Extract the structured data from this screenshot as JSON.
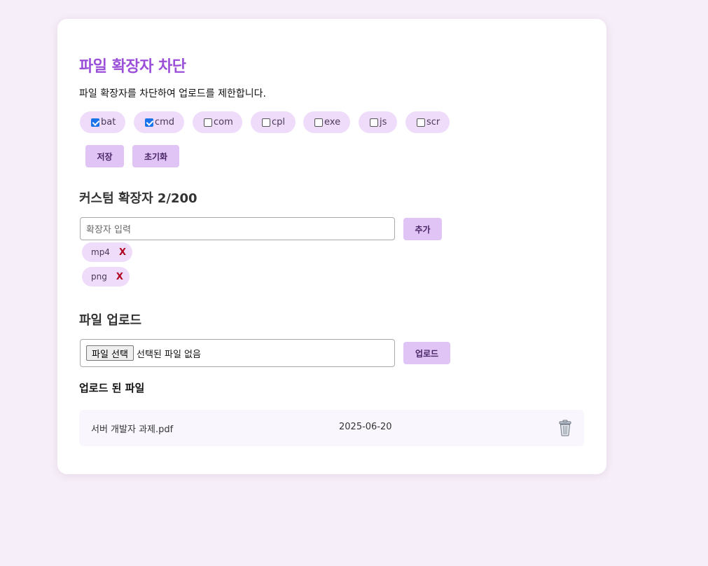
{
  "header": {
    "title": "파일 확장자 차단",
    "description": "파일 확장자를 차단하여 업로드를 제한합니다."
  },
  "fixed_extensions": [
    {
      "label": "bat",
      "checked": true
    },
    {
      "label": "cmd",
      "checked": true
    },
    {
      "label": "com",
      "checked": false
    },
    {
      "label": "cpl",
      "checked": false
    },
    {
      "label": "exe",
      "checked": false
    },
    {
      "label": "js",
      "checked": false
    },
    {
      "label": "scr",
      "checked": false
    }
  ],
  "actions": {
    "save_label": "저장",
    "reset_label": "초기화"
  },
  "custom": {
    "heading": "커스텀 확장자 2/200",
    "placeholder": "확장자 입력",
    "add_label": "추가",
    "tags": [
      {
        "label": "mp4",
        "remove": "X"
      },
      {
        "label": "png",
        "remove": "X"
      }
    ]
  },
  "upload": {
    "heading": "파일 업로드",
    "choose_label": "파일 선택",
    "no_file_label": "선택된 파일 없음",
    "upload_label": "업로드"
  },
  "uploaded": {
    "heading": "업로드 된 파일",
    "files": [
      {
        "name": "서버 개발자 과제.pdf",
        "date": "2025-06-20",
        "icon": "trash-icon"
      }
    ]
  },
  "colors": {
    "accent": "#9b4fd8",
    "chip": "#efdcfa",
    "button": "#dfc4f5",
    "background": "#f6eef8"
  }
}
